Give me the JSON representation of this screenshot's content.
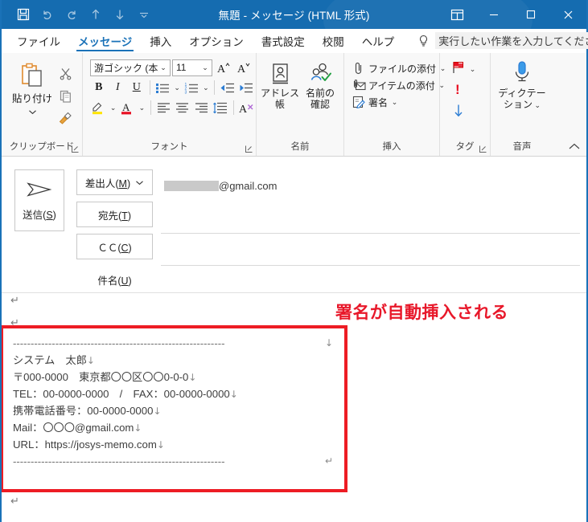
{
  "window": {
    "title": "無題  -  メッセージ (HTML 形式)",
    "quick_access": [
      {
        "name": "save",
        "icon": "save-icon"
      },
      {
        "name": "undo",
        "icon": "undo-icon"
      },
      {
        "name": "redo",
        "icon": "redo-icon"
      },
      {
        "name": "previous-item",
        "icon": "arrow-up-icon"
      },
      {
        "name": "next-item",
        "icon": "arrow-down-icon"
      },
      {
        "name": "customize-quick-access",
        "icon": "chevron-down-icon"
      }
    ],
    "controls": {
      "ribbon_display": "ribbon-display-options-icon",
      "minimize": "minimize-icon",
      "maximize": "maximize-icon",
      "close": "close-icon"
    }
  },
  "ribbon": {
    "tabs": [
      {
        "label": "ファイル",
        "active": false
      },
      {
        "label": "メッセージ",
        "active": true
      },
      {
        "label": "挿入",
        "active": false
      },
      {
        "label": "オプション",
        "active": false
      },
      {
        "label": "書式設定",
        "active": false
      },
      {
        "label": "校閲",
        "active": false
      },
      {
        "label": "ヘルプ",
        "active": false
      }
    ],
    "tell_me": {
      "icon": "lightbulb-icon",
      "placeholder": "実行したい作業を入力してください"
    },
    "collapse_icon": "chevron-up-icon",
    "groups": {
      "clipboard": {
        "label": "クリップボード",
        "paste_label": "貼り付け",
        "items": [
          "cut-scissors-icon",
          "copy-icon",
          "format-painter-icon"
        ]
      },
      "font": {
        "label": "フォント",
        "font_name": "游ゴシック (本文の:",
        "font_size": "11",
        "grow_font": "A",
        "shrink_font": "A",
        "bold": "B",
        "italic": "I",
        "underline": "U"
      },
      "names": {
        "label": "名前",
        "address_book": "アドレス帳",
        "check_names_line1": "名前の",
        "check_names_line2": "確認"
      },
      "include": {
        "label": "挿入",
        "attach_file": "ファイルの添付",
        "attach_item": "アイテムの添付",
        "signature": "署名"
      },
      "tags": {
        "label": "タグ",
        "follow_up": "flag-icon",
        "high_importance": "!",
        "low_importance": "arrow-down-icon"
      },
      "voice": {
        "label": "音声",
        "dictate_line1": "ディクテー",
        "dictate_line2": "ション"
      }
    }
  },
  "compose": {
    "send_button": {
      "label_prefix": "送信(",
      "accel": "S",
      "label_suffix": ")"
    },
    "from": {
      "label_prefix": "差出人(",
      "accel": "M",
      "label_suffix": ")",
      "value": "@gmail.com",
      "value_redacted": true
    },
    "to": {
      "label_prefix": "宛先(",
      "accel": "T",
      "label_suffix": ")",
      "value": ""
    },
    "cc": {
      "label_prefix": "ＣＣ(",
      "accel": "C",
      "label_suffix": ")",
      "value": ""
    },
    "subject": {
      "label_prefix": "件名(",
      "accel": "U",
      "label_suffix": ")",
      "value": ""
    }
  },
  "body": {
    "annotation": "署名が自動挿入される",
    "annotation_color": "#E8182A",
    "highlight_color": "#ED1C24",
    "paragraph_mark": "↵",
    "line_break_mark": "↓",
    "signature": {
      "divider_top": "------------------------------------------------------------",
      "line_name": "システム　太郎",
      "line_address": "〒000-0000　東京都〇〇区〇〇0-0-0",
      "line_tel": "TEL：00-0000-0000　/　FAX：00-0000-0000",
      "line_mobile": "携帯電話番号：00-0000-0000",
      "line_mail": "Mail：〇〇〇@gmail.com",
      "line_url": "URL：https://josys-memo.com",
      "divider_bottom": "------------------------------------------------------------"
    }
  }
}
